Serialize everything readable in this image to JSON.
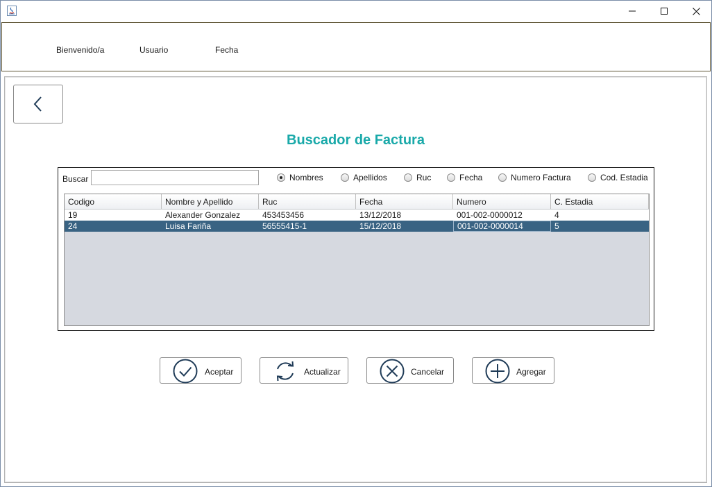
{
  "header": {
    "welcome": "Bienvenido/a",
    "user": "Usuario",
    "date": "Fecha"
  },
  "main": {
    "title": "Buscador de Factura"
  },
  "search": {
    "label": "Buscar",
    "value": "",
    "placeholder": ""
  },
  "filters": [
    {
      "label": "Nombres",
      "selected": true
    },
    {
      "label": "Apellidos",
      "selected": false
    },
    {
      "label": "Ruc",
      "selected": false
    },
    {
      "label": "Fecha",
      "selected": false
    },
    {
      "label": "Numero Factura",
      "selected": false
    },
    {
      "label": "Cod. Estadia",
      "selected": false
    }
  ],
  "table": {
    "columns": [
      "Codigo",
      "Nombre y Apellido",
      "Ruc",
      "Fecha",
      "Numero",
      "C. Estadia"
    ],
    "rows": [
      [
        "19",
        "Alexander Gonzalez",
        "453453456",
        "13/12/2018",
        "001-002-0000012",
        "4"
      ],
      [
        "24",
        "Luisa Fariña",
        "56555415-1",
        "15/12/2018",
        "001-002-0000014",
        "5"
      ]
    ],
    "selected_row": 1
  },
  "actions": {
    "accept": "Aceptar",
    "refresh": "Actualizar",
    "cancel": "Cancelar",
    "add": "Agregar"
  },
  "icons": {
    "app": "java-icon",
    "back": "chevron-left-icon",
    "accept": "check-circle-icon",
    "refresh": "refresh-icon",
    "cancel": "x-circle-icon",
    "add": "plus-circle-icon"
  },
  "colors": {
    "title": "#19a9a9",
    "selection": "#396383",
    "icon": "#1f3b57"
  }
}
